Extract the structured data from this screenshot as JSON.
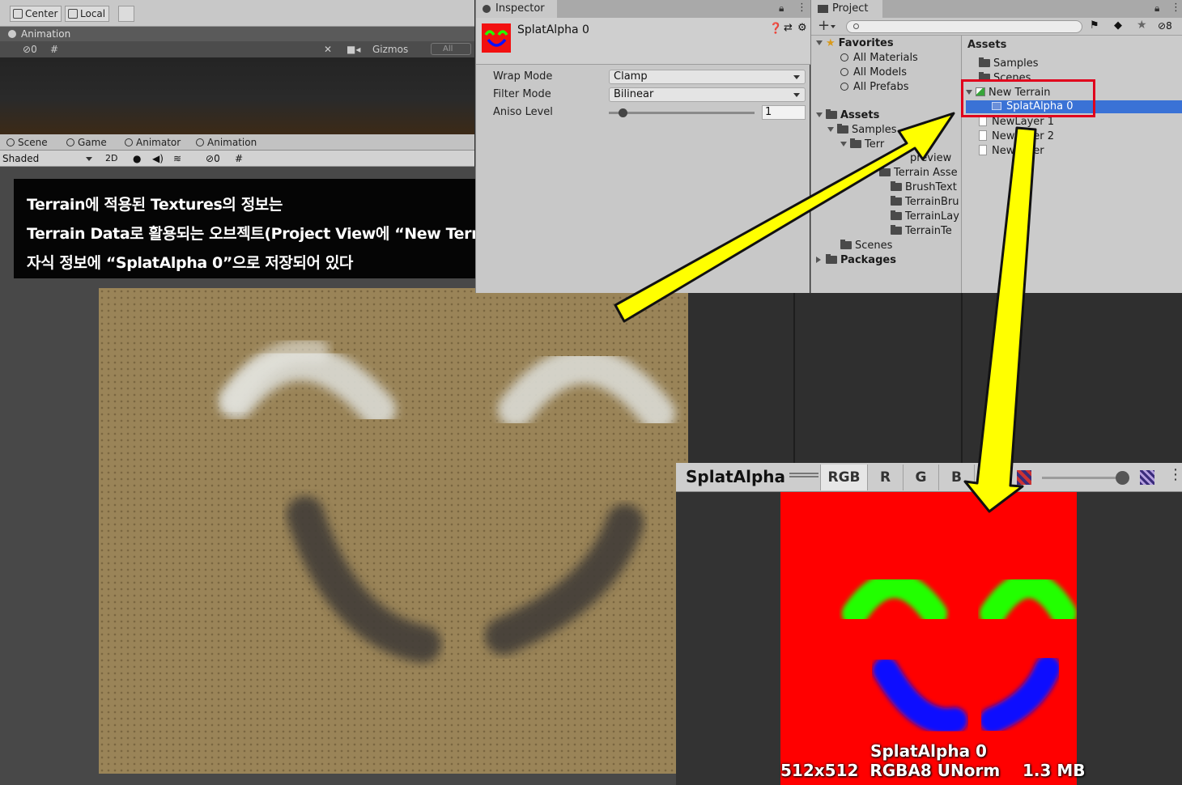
{
  "toolbar": {
    "pivot_label": "Center",
    "space_label": "Local"
  },
  "animation_panel": {
    "title": "Animation",
    "gizmos_label": "Gizmos",
    "search_placeholder": "All",
    "hidden_count": "0"
  },
  "scene_panel": {
    "tabs": [
      {
        "label": "Scene",
        "icon": "grid-icon"
      },
      {
        "label": "Game",
        "icon": "gamepad-icon"
      },
      {
        "label": "Animator",
        "icon": "animator-icon"
      },
      {
        "label": "Animation",
        "icon": "clock-icon"
      }
    ],
    "shading_mode": "Shaded",
    "mode_2d": "2D",
    "hidden_count": "0"
  },
  "caption": {
    "line1": "Terrain에 적용된 Textures의 정보는",
    "line2": "Terrain Data로 활용되는 오브젝트(Project View에 “New Terrain”)의",
    "line3": "자식 정보에 “SplatAlpha 0”으로 저장되어 있다"
  },
  "inspector": {
    "tab_label": "Inspector",
    "asset_name": "SplatAlpha 0",
    "properties": {
      "wrap_mode": {
        "label": "Wrap Mode",
        "value": "Clamp"
      },
      "filter_mode": {
        "label": "Filter Mode",
        "value": "Bilinear"
      },
      "aniso_level": {
        "label": "Aniso Level",
        "value": "1",
        "slider_fraction": 0.0
      }
    }
  },
  "project": {
    "tab_label": "Project",
    "hidden_count": "8",
    "tree": {
      "favorites": {
        "label": "Favorites",
        "items": [
          "All Materials",
          "All Models",
          "All Prefabs"
        ]
      },
      "assets": {
        "label": "Assets",
        "samples": "Samples",
        "terrain_partial": "Terr",
        "preview": "preview",
        "terrain_assets": "Terrain Asse",
        "children": [
          "BrushText",
          "TerrainBru",
          "TerrainLay",
          "TerrainTe"
        ],
        "scenes": "Scenes"
      },
      "packages": "Packages"
    },
    "list": {
      "header": "Assets",
      "items": [
        {
          "label": "Samples",
          "icon": "folder-icon"
        },
        {
          "label": "Scenes",
          "icon": "folder-icon"
        },
        {
          "label": "New Terrain",
          "icon": "terrain-icon"
        },
        {
          "label": "SplatAlpha 0",
          "icon": "texture-icon",
          "selected": true
        },
        {
          "label": "NewLayer 1",
          "icon": "document-icon"
        },
        {
          "label": "NewLayer 2",
          "icon": "document-icon"
        },
        {
          "label": "NewLayer",
          "icon": "document-icon"
        }
      ]
    }
  },
  "preview": {
    "title": "SplatAlpha",
    "channels": [
      "RGB",
      "R",
      "G",
      "B"
    ],
    "active_channel": "RGB",
    "mip_fraction": 1.0,
    "info_name": "SplatAlpha 0",
    "info_details": "512x512  RGBA8 UNorm    1.3 MB"
  },
  "colors": {
    "splat_background": "#ff0000",
    "splat_eyes": "#22ff00",
    "splat_mouth": "#0a10ff",
    "highlight_box": "#e0001c",
    "arrow_fill": "#ffff00",
    "selection": "#3a72d6",
    "terrain_base": "#9a8458"
  }
}
